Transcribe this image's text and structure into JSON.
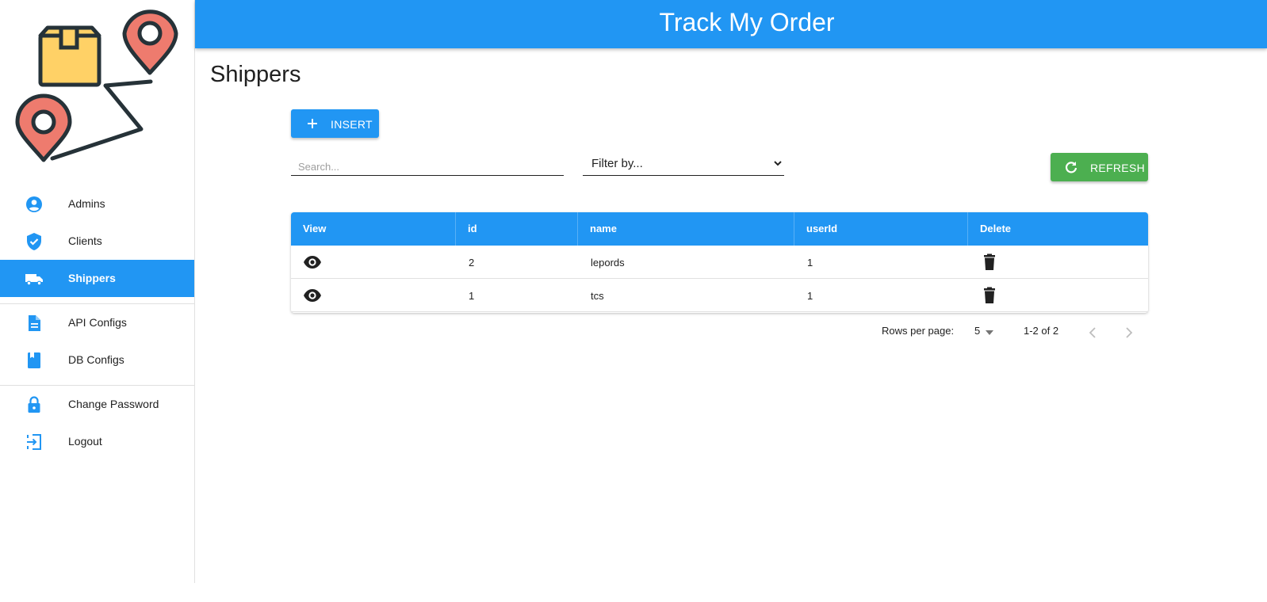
{
  "app": {
    "title": "Track My Order"
  },
  "sidebar": {
    "items": [
      {
        "label": "Admins",
        "icon": "account-circle-icon",
        "active": false
      },
      {
        "label": "Clients",
        "icon": "verified-shield-icon",
        "active": false
      },
      {
        "label": "Shippers",
        "icon": "truck-icon",
        "active": true
      },
      {
        "label": "API Configs",
        "icon": "document-icon",
        "active": false
      },
      {
        "label": "DB Configs",
        "icon": "book-icon",
        "active": false
      },
      {
        "label": "Change Password",
        "icon": "lock-icon",
        "active": false
      },
      {
        "label": "Logout",
        "icon": "logout-icon",
        "active": false
      }
    ]
  },
  "page": {
    "title": "Shippers"
  },
  "toolbar": {
    "insert_label": "INSERT",
    "refresh_label": "REFRESH",
    "search_placeholder": "Search...",
    "search_value": "",
    "filter_selected": "Filter by..."
  },
  "table": {
    "columns": [
      "View",
      "id",
      "name",
      "userId",
      "Delete"
    ],
    "rows": [
      {
        "id": "2",
        "name": "lepords",
        "userId": "1"
      },
      {
        "id": "1",
        "name": "tcs",
        "userId": "1"
      }
    ]
  },
  "pagination": {
    "rows_per_page_label": "Rows per page:",
    "rows_per_page": "5",
    "range": "1-2 of 2"
  },
  "colors": {
    "primary": "#2196f3",
    "success": "#4caf50",
    "logo_box": "#ffd166",
    "logo_pin": "#ee7b6e",
    "logo_stroke": "#263238"
  }
}
